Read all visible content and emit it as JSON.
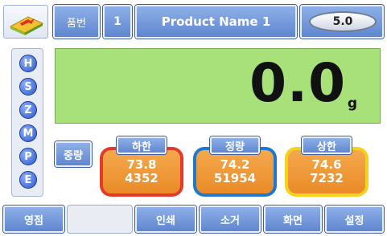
{
  "header": {
    "item_no_label": "품번",
    "item_no_value": "1",
    "product_name": "Product Name 1",
    "version": "5.0"
  },
  "side_buttons": [
    "H",
    "S",
    "Z",
    "M",
    "P",
    "E"
  ],
  "display": {
    "weight": "0.0",
    "unit": "g",
    "background_color": "#a8e07a"
  },
  "weight_label": "중량",
  "limits": {
    "lower": {
      "label": "하한",
      "value": "73.8",
      "count": "4352",
      "color": "#e53a2b"
    },
    "target": {
      "label": "정량",
      "value": "74.2",
      "count": "51954",
      "color": "#1e78d2"
    },
    "upper": {
      "label": "상한",
      "value": "74.6",
      "count": "7232",
      "color": "#f5d21e"
    }
  },
  "bottom_bar": {
    "open_label": "영점",
    "blank_label": "",
    "print_label": "인쇄",
    "clear_label": "소거",
    "screen_label": "화면",
    "settings_label": "설정"
  }
}
